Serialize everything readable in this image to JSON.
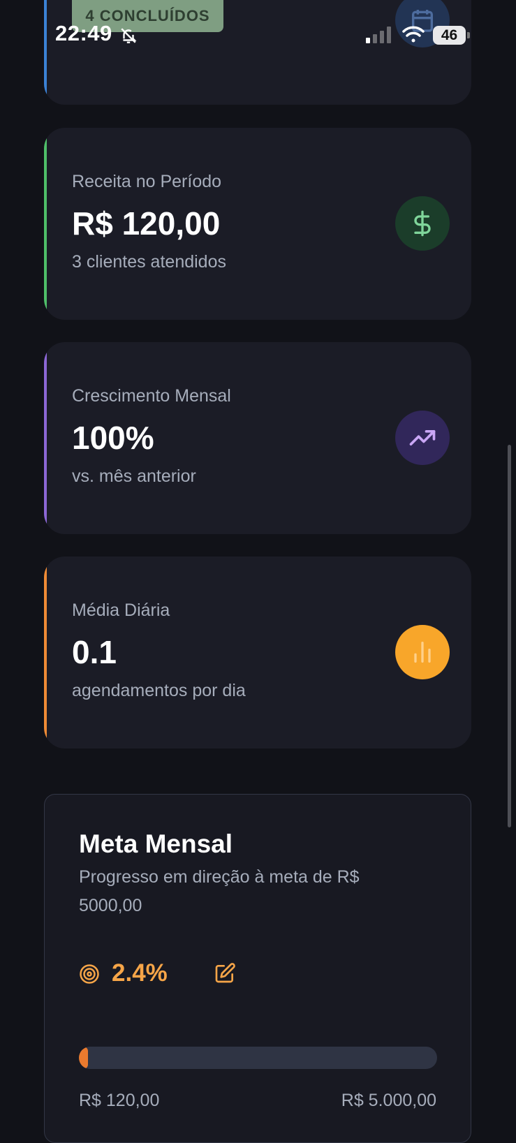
{
  "status_bar": {
    "time": "22:49",
    "battery": "46"
  },
  "top_card": {
    "badge": "4 CONCLUÍDOS"
  },
  "cards": [
    {
      "label": "Receita no Período",
      "value": "R$ 120,00",
      "sub": "3 clientes atendidos",
      "accent": "#4fbf69",
      "icon": "dollar-icon",
      "icon_bg": "#1b3d2a",
      "icon_color": "#7fd59a"
    },
    {
      "label": "Crescimento Mensal",
      "value": "100%",
      "sub": "vs. mês anterior",
      "accent": "#8c67d6",
      "icon": "trending-up-icon",
      "icon_bg": "#31275a",
      "icon_color": "#c9a6f5"
    },
    {
      "label": "Média Diária",
      "value": "0.1",
      "sub": "agendamentos por dia",
      "accent": "#ef8b35",
      "icon": "bar-chart-icon",
      "icon_bg": "#f8a62a",
      "icon_color": "#ffd08a"
    }
  ],
  "goal": {
    "title": "Meta Mensal",
    "description": "Progresso em direção à meta de R$ 5000,00",
    "percent": "2.4%",
    "progress_fraction": 0.024,
    "current": "R$ 120,00",
    "target": "R$ 5.000,00"
  },
  "colors": {
    "background": "#111218",
    "card": "#1b1c26",
    "accent_orange": "#f6a548"
  }
}
